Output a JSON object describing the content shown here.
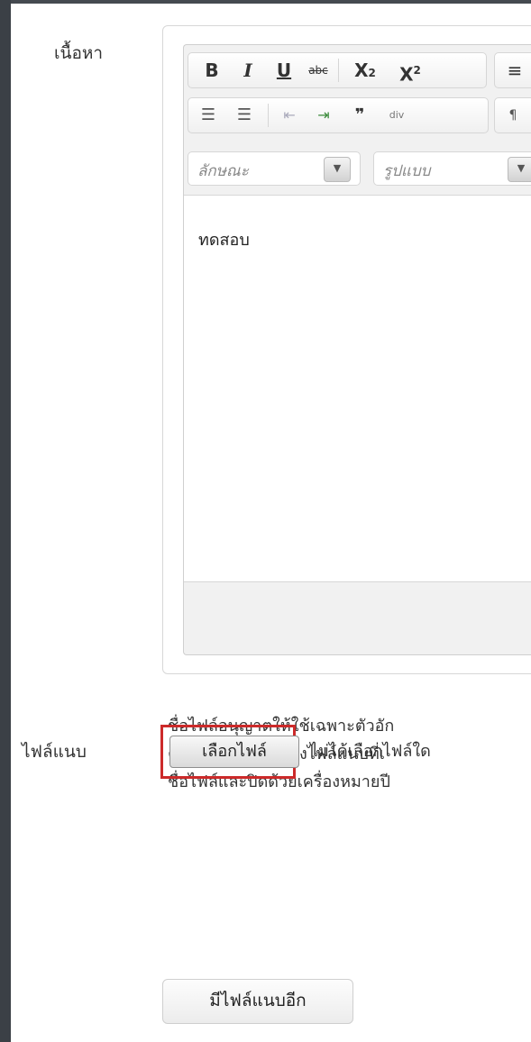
{
  "form": {
    "content_label": "เนื้อหา",
    "attachment_label": "ไฟล์แนบ"
  },
  "toolbar": {
    "row1": [
      {
        "icon": "bold-icon",
        "glyph": "B"
      },
      {
        "icon": "italic-icon",
        "glyph": "I"
      },
      {
        "icon": "underline-icon",
        "glyph": "U"
      },
      {
        "icon": "strikethrough-icon",
        "glyph": "abc"
      },
      {
        "icon": "subscript-icon",
        "glyph": "X₂"
      },
      {
        "icon": "superscript-icon",
        "glyph": "X²"
      },
      {
        "icon": "align-left-icon",
        "glyph": "≡"
      }
    ],
    "row2": [
      {
        "icon": "numbered-list-icon",
        "glyph": "☰"
      },
      {
        "icon": "bullet-list-icon",
        "glyph": "☰"
      },
      {
        "icon": "outdent-icon",
        "glyph": "⇤"
      },
      {
        "icon": "indent-icon",
        "glyph": "⇥"
      },
      {
        "icon": "blockquote-icon",
        "glyph": "❞"
      },
      {
        "icon": "div-container-icon",
        "glyph": "div"
      },
      {
        "icon": "paragraph-ltr-icon",
        "glyph": "¶"
      }
    ],
    "style_combo": "ลักษณะ",
    "format_combo": "รูปแบบ",
    "combo_arrow": "▼"
  },
  "editor": {
    "content": "ทดสอบ"
  },
  "help": {
    "line1": "ชื่อไฟล์อนุญาตให้ใช้เฉพาะตัวอัก",
    "line2": "คุณยังสามารถแสดงไฟล์แนบที่เ",
    "line3": "ชื่อไฟล์และปิดด้วยเครื่องหมายปี"
  },
  "attachment": {
    "choose_label": "เลือกไฟล์",
    "status": "ไม่ได้เลือกไฟล์ใด",
    "more_label": "มีไฟล์แนบอีก"
  },
  "colors": {
    "highlight": "#cc2a2a"
  }
}
